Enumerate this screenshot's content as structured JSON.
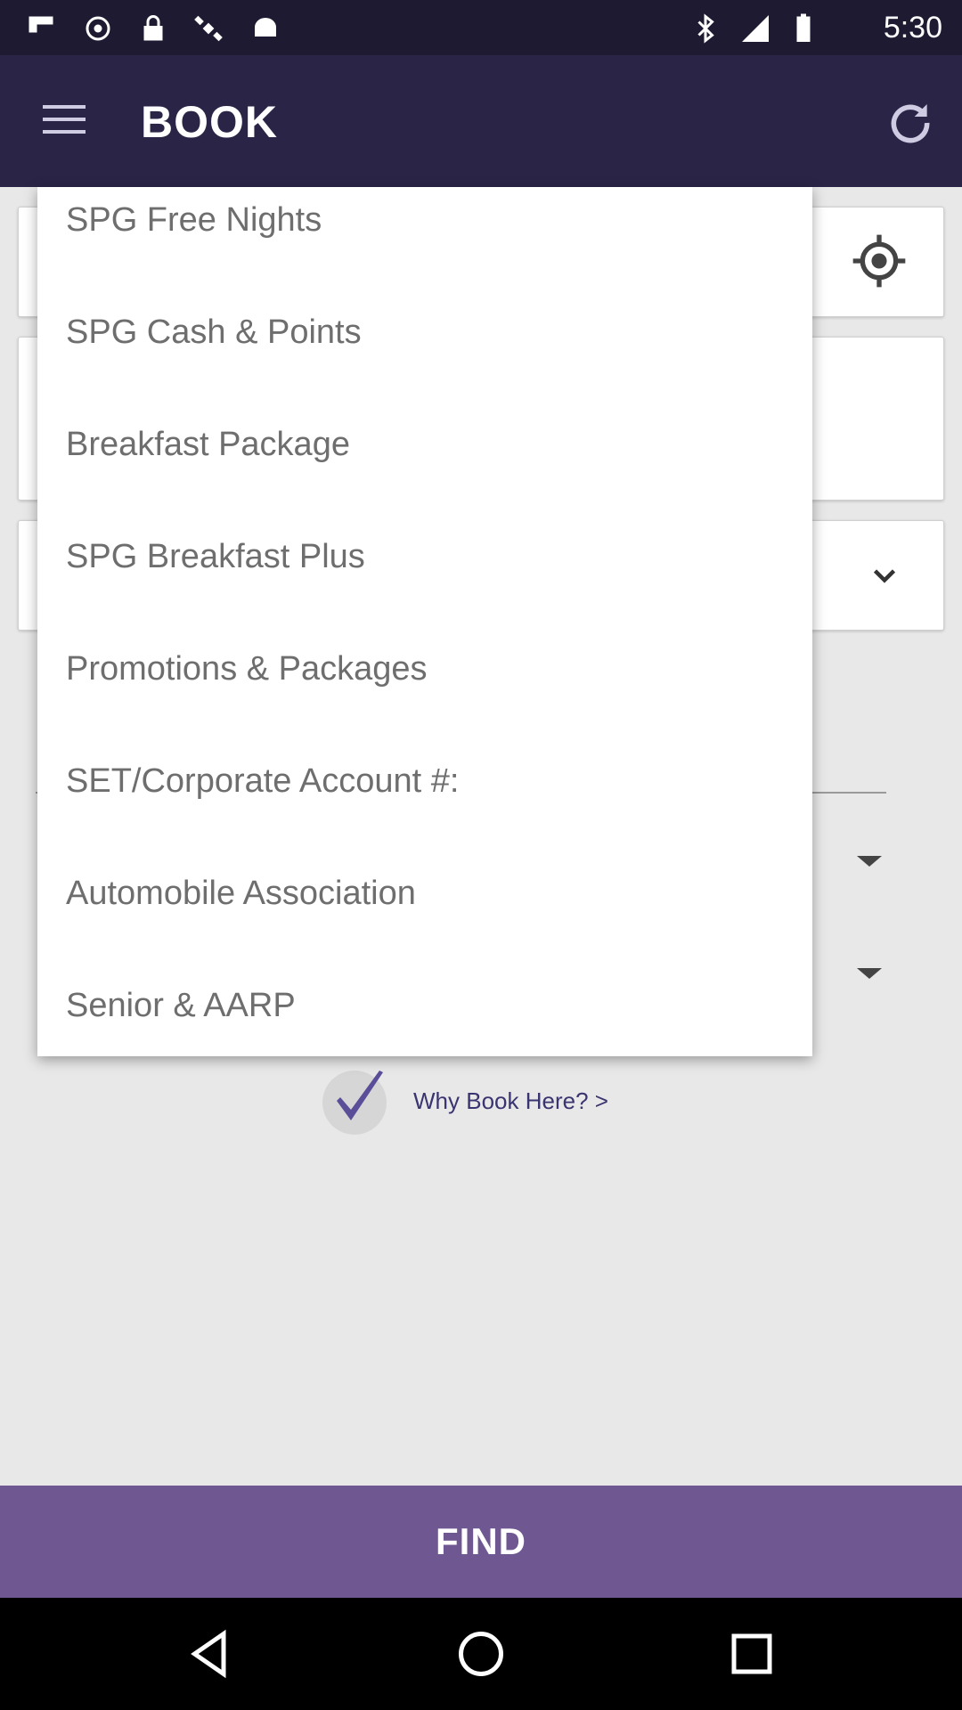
{
  "status_bar": {
    "time": "5:30",
    "icons": [
      "flipboard-icon",
      "sync-icon",
      "lock-icon",
      "satellite-icon",
      "android-icon",
      "bluetooth-icon",
      "signal-icon",
      "battery-icon"
    ]
  },
  "app_bar": {
    "title": "BOOK",
    "menu_icon": "menu-icon",
    "refresh_icon": "refresh-icon"
  },
  "form": {
    "locate_icon": "locate-icon",
    "rate_chevron": "chevron-down-icon"
  },
  "dropdown": {
    "items": [
      "SPG Free Nights",
      "SPG Cash & Points",
      "Breakfast Package",
      "SPG Breakfast Plus",
      "Promotions & Packages",
      "SET/Corporate Account #:",
      "Automobile Association",
      "Senior & AARP"
    ]
  },
  "why_book": {
    "label": "Why Book Here? >",
    "icon": "check-icon"
  },
  "find_button": {
    "label": "FIND"
  },
  "colors": {
    "app_bar": "#2a2447",
    "status_bar": "#1d1a31",
    "accent": "#6f5792",
    "check": "#5a4e99"
  }
}
